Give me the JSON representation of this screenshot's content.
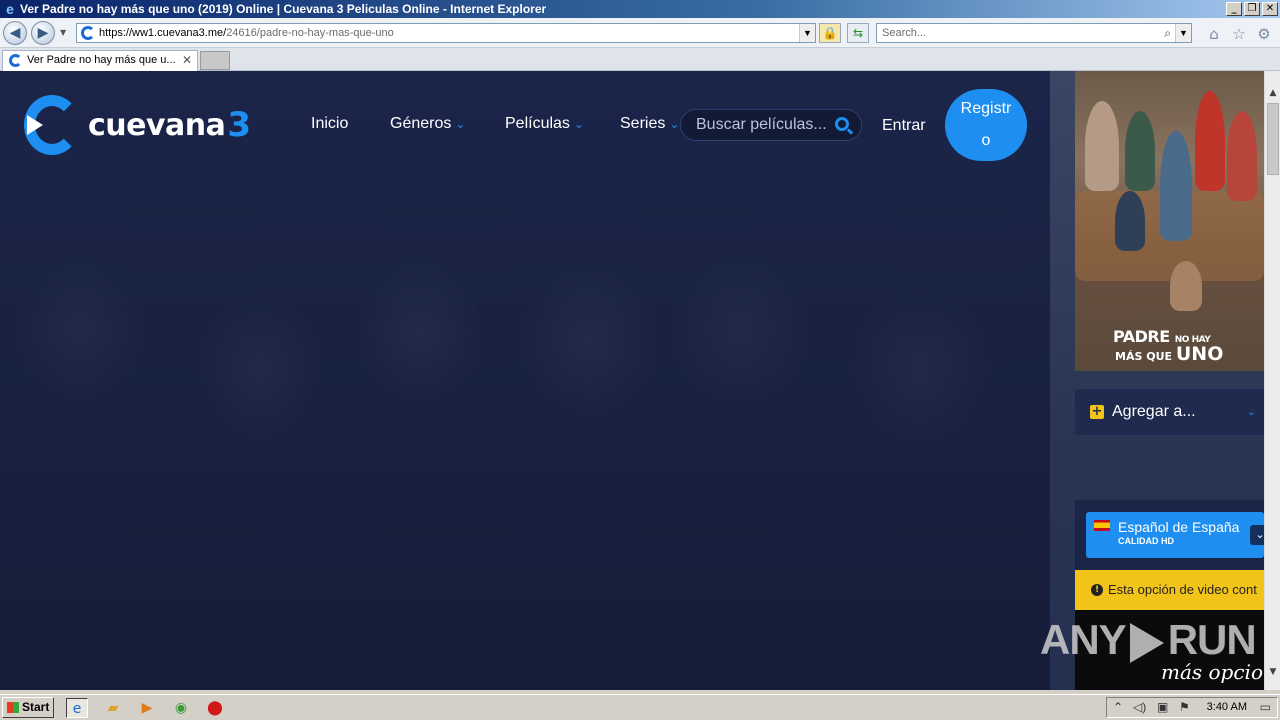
{
  "window": {
    "title": "Ver Padre no hay más que uno (2019) Online | Cuevana 3 Peliculas Online - Internet Explorer",
    "buttons": [
      "_",
      "❐",
      "✕"
    ]
  },
  "address_bar": {
    "url_host": "https://ww1.cuevana3.me/",
    "url_path": "24616/padre-no-hay-mas-que-uno"
  },
  "search_bar": {
    "placeholder": "Search..."
  },
  "tabs": [
    {
      "label": "Ver Padre no hay más que u...",
      "active": true
    }
  ],
  "site": {
    "logo_word": "cuevana",
    "logo_num": "3",
    "nav": [
      {
        "label": "Inicio",
        "dropdown": false
      },
      {
        "label": "Géneros",
        "dropdown": true
      },
      {
        "label": "Películas",
        "dropdown": true
      },
      {
        "label": "Series",
        "dropdown": true
      }
    ],
    "search_placeholder": "Buscar películas...",
    "login_label": "Entrar",
    "register_label": "Registro",
    "accent_color": "#1e8ff0"
  },
  "poster": {
    "title_line1": "PADRE",
    "title_line1_small": "NO HAY",
    "title_line2_small": "MÁS QUE",
    "title_line2": "UNO"
  },
  "add_to": {
    "label": "Agregar a..."
  },
  "player": {
    "language": "Español de España",
    "quality": "CALIDAD HD",
    "warning": "Esta opción de video cont",
    "more_options": "más opcio"
  },
  "watermark": {
    "left": "ANY",
    "right": "RUN"
  },
  "taskbar": {
    "start_label": "Start",
    "clock": "3:40 AM"
  }
}
